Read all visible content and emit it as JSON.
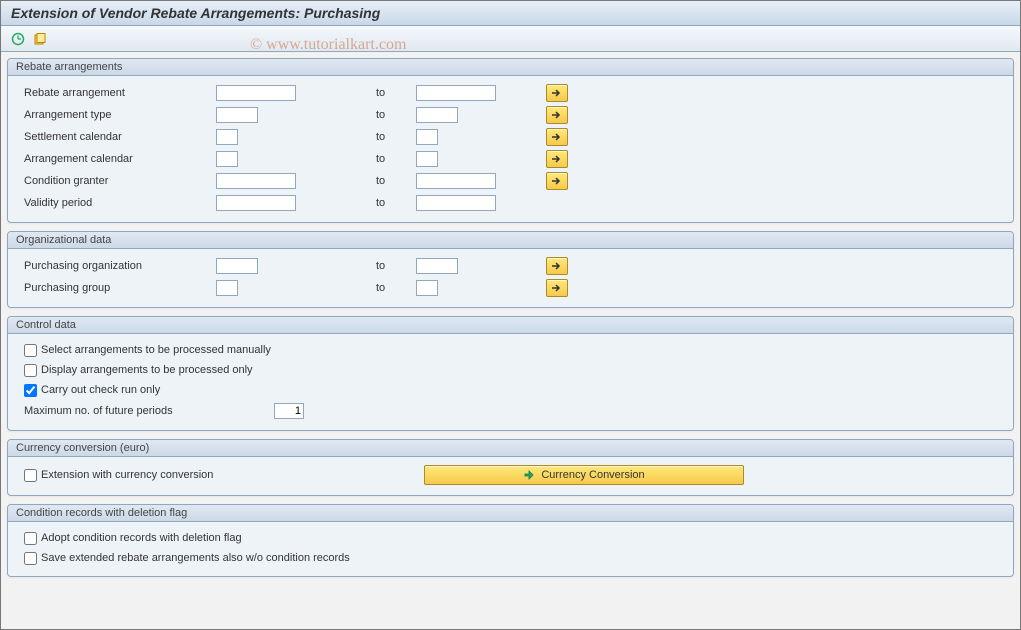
{
  "title": "Extension of Vendor Rebate Arrangements: Purchasing",
  "watermark": "© www.tutorialkart.com",
  "to_label": "to",
  "panels": {
    "rebate": {
      "header": "Rebate arrangements",
      "rows": {
        "rebate_arr": {
          "label": "Rebate arrangement",
          "from": "",
          "to": "",
          "from_w": "in-long",
          "to_w": "in-long",
          "multi": true
        },
        "arr_type": {
          "label": "Arrangement type",
          "from": "",
          "to": "",
          "from_w": "in-med",
          "to_w": "in-med",
          "multi": true
        },
        "settle_cal": {
          "label": "Settlement calendar",
          "from": "",
          "to": "",
          "from_w": "in-short",
          "to_w": "in-short",
          "multi": true
        },
        "arr_cal": {
          "label": "Arrangement calendar",
          "from": "",
          "to": "",
          "from_w": "in-short",
          "to_w": "in-short",
          "multi": true
        },
        "cond_granter": {
          "label": "Condition granter",
          "from": "",
          "to": "",
          "from_w": "in-long",
          "to_w": "in-long",
          "multi": true
        },
        "validity": {
          "label": "Validity period",
          "from": "",
          "to": "",
          "from_w": "in-long",
          "to_w": "in-long",
          "multi": false
        }
      }
    },
    "org": {
      "header": "Organizational data",
      "rows": {
        "purch_org": {
          "label": "Purchasing organization",
          "from": "",
          "to": "",
          "from_w": "in-med",
          "to_w": "in-med",
          "multi": true
        },
        "purch_grp": {
          "label": "Purchasing group",
          "from": "",
          "to": "",
          "from_w": "in-short",
          "to_w": "in-short",
          "multi": true
        }
      }
    },
    "control": {
      "header": "Control data",
      "checks": {
        "manual": {
          "label": "Select arrangements to be processed manually",
          "checked": false
        },
        "display_only": {
          "label": "Display arrangements to be processed only",
          "checked": false
        },
        "check_run": {
          "label": "Carry out check run only",
          "checked": true
        }
      },
      "max_periods": {
        "label": "Maximum no. of future periods",
        "value": "1"
      }
    },
    "currency": {
      "header": "Currency conversion (euro)",
      "ext_conv": {
        "label": "Extension with currency conversion",
        "checked": false
      },
      "button": "Currency Conversion"
    },
    "deletion": {
      "header": "Condition records with deletion flag",
      "adopt": {
        "label": "Adopt condition records with deletion flag",
        "checked": false
      },
      "save": {
        "label": "Save extended rebate arrangements also w/o condition records",
        "checked": false
      }
    }
  }
}
